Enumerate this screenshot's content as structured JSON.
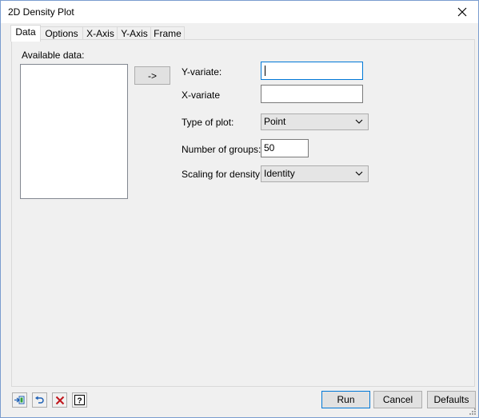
{
  "window": {
    "title": "2D Density Plot"
  },
  "tabs": [
    {
      "label": "Data",
      "active": true
    },
    {
      "label": "Options",
      "active": false
    },
    {
      "label": "X-Axis",
      "active": false
    },
    {
      "label": "Y-Axis",
      "active": false
    },
    {
      "label": "Frame",
      "active": false
    }
  ],
  "data_tab": {
    "available_data_label": "Available data:",
    "transfer_button_label": "->",
    "y_variate_label": "Y-variate:",
    "y_variate_value": "",
    "x_variate_label": "X-variate",
    "x_variate_value": "",
    "type_of_plot_label": "Type of plot:",
    "type_of_plot_value": "Point",
    "number_of_groups_label": "Number of groups:",
    "number_of_groups_value": "50",
    "scaling_label": "Scaling for density:",
    "scaling_value": "Identity"
  },
  "footer": {
    "run_label": "Run",
    "cancel_label": "Cancel",
    "defaults_label": "Defaults",
    "icons": [
      "pin-icon",
      "undo-icon",
      "clear-icon",
      "help-icon"
    ]
  },
  "colors": {
    "accent": "#0078d7",
    "window_border": "#7a9ccf",
    "clear_icon_red": "#c0151b",
    "undo_icon_blue": "#1c5fb5"
  }
}
